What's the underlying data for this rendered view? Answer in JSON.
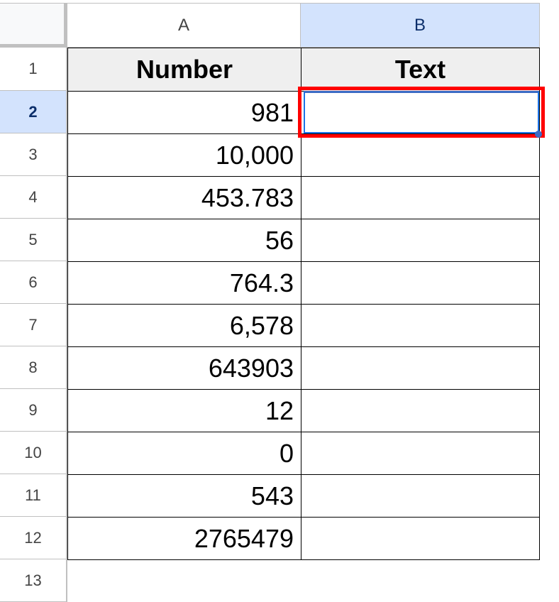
{
  "columns": [
    "A",
    "B"
  ],
  "selected_column": "B",
  "row_numbers": [
    "1",
    "2",
    "3",
    "4",
    "5",
    "6",
    "7",
    "8",
    "9",
    "10",
    "11",
    "12",
    "13"
  ],
  "selected_row": "2",
  "headers": {
    "a": "Number",
    "b": "Text"
  },
  "values": [
    "981",
    "10,000",
    "453.783",
    "56",
    "764.3",
    "6,578",
    "643903",
    "12",
    "0",
    "543",
    "2765479"
  ],
  "highlight_color": "#ff0000",
  "selection_color": "#1a73e8"
}
